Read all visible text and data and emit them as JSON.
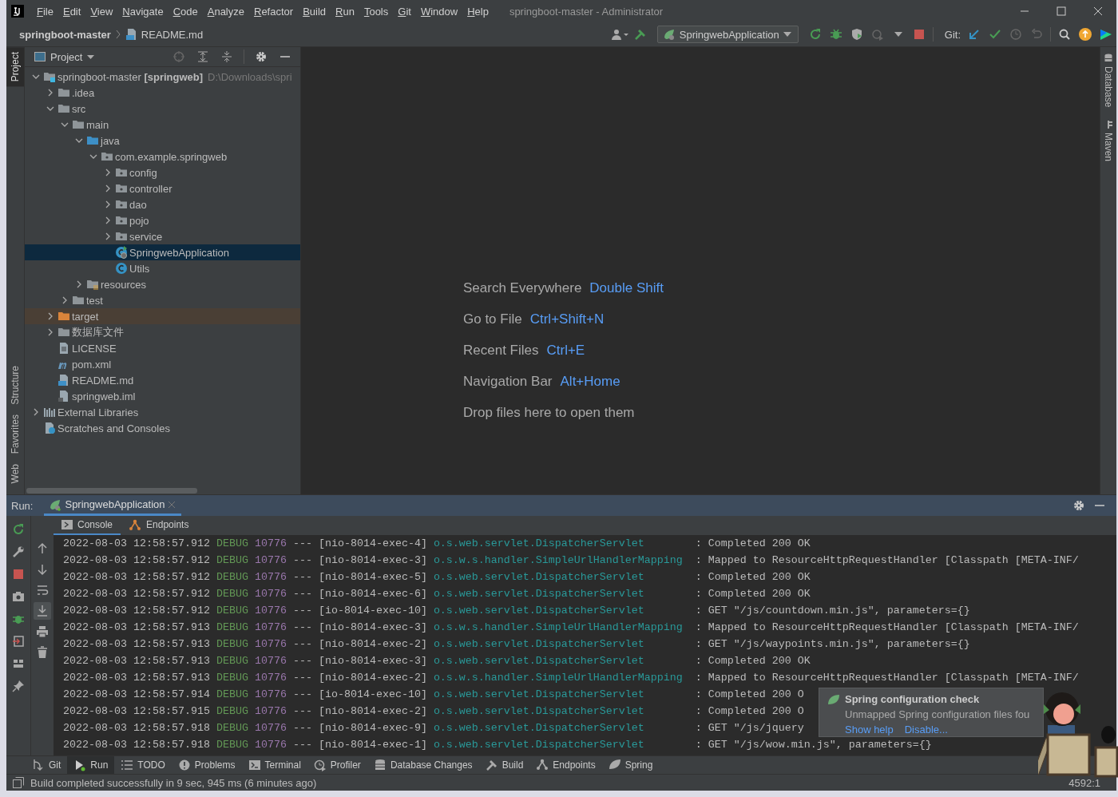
{
  "window": {
    "title": "springboot-master - Administrator",
    "menus": [
      "File",
      "Edit",
      "View",
      "Navigate",
      "Code",
      "Analyze",
      "Refactor",
      "Build",
      "Run",
      "Tools",
      "Git",
      "Window",
      "Help"
    ]
  },
  "navbar": {
    "breadcrumbs": [
      {
        "label": "springboot-master",
        "kind": "project"
      },
      {
        "label": "README.md",
        "kind": "markdown"
      }
    ],
    "run_config": "SpringwebApplication",
    "git_label": "Git:"
  },
  "left_tool_strip": [
    {
      "label": "Project",
      "selected": true
    },
    {
      "label": "Structure",
      "selected": false
    },
    {
      "label": "Favorites",
      "selected": false
    },
    {
      "label": "Web",
      "selected": false
    }
  ],
  "right_tool_strip": [
    {
      "label": "Database",
      "kind": "database"
    },
    {
      "label": "Maven",
      "kind": "maven"
    }
  ],
  "project_panel": {
    "title": "Project",
    "tree": [
      {
        "label": "springboot-master **[springweb]**",
        "path": "D:\\Downloads\\spri",
        "kind": "module",
        "expanded": true,
        "selected": false,
        "children": [
          {
            "label": ".idea",
            "kind": "folder",
            "expanded": false,
            "selected": false
          },
          {
            "label": "src",
            "kind": "folder",
            "expanded": true,
            "selected": false,
            "children": [
              {
                "label": "main",
                "kind": "folder",
                "expanded": true,
                "selected": false,
                "children": [
                  {
                    "label": "java",
                    "kind": "source-folder",
                    "expanded": true,
                    "selected": false,
                    "children": [
                      {
                        "label": "com.example.springweb",
                        "kind": "package",
                        "expanded": true,
                        "selected": false,
                        "children": [
                          {
                            "label": "config",
                            "kind": "package",
                            "expanded": false,
                            "selected": false
                          },
                          {
                            "label": "controller",
                            "kind": "package",
                            "expanded": false,
                            "selected": false
                          },
                          {
                            "label": "dao",
                            "kind": "package",
                            "expanded": false,
                            "selected": false
                          },
                          {
                            "label": "pojo",
                            "kind": "package",
                            "expanded": false,
                            "selected": false
                          },
                          {
                            "label": "service",
                            "kind": "package",
                            "expanded": false,
                            "selected": false
                          },
                          {
                            "label": "SpringwebApplication",
                            "kind": "main-class",
                            "selected": true
                          },
                          {
                            "label": "Utils",
                            "kind": "class",
                            "selected": false
                          }
                        ]
                      }
                    ]
                  },
                  {
                    "label": "resources",
                    "kind": "resources-folder",
                    "expanded": false,
                    "selected": false
                  }
                ]
              },
              {
                "label": "test",
                "kind": "folder",
                "expanded": false,
                "selected": false
              }
            ]
          },
          {
            "label": "target",
            "kind": "excluded-folder",
            "expanded": false,
            "selected": false
          },
          {
            "label": "数据库文件",
            "kind": "folder",
            "expanded": false,
            "selected": false
          },
          {
            "label": "LICENSE",
            "kind": "text-file",
            "selected": false
          },
          {
            "label": "pom.xml",
            "kind": "maven-file",
            "selected": false
          },
          {
            "label": "README.md",
            "kind": "markdown-file",
            "selected": false
          },
          {
            "label": "springweb.iml",
            "kind": "iml-file",
            "selected": false
          }
        ]
      },
      {
        "label": "External Libraries",
        "kind": "libraries",
        "expanded": false,
        "selected": false
      },
      {
        "label": "Scratches and Consoles",
        "kind": "scratches",
        "selected": false
      }
    ]
  },
  "editor_hints": [
    {
      "action": "Search Everywhere",
      "shortcut": "Double Shift"
    },
    {
      "action": "Go to File",
      "shortcut": "Ctrl+Shift+N"
    },
    {
      "action": "Recent Files",
      "shortcut": "Ctrl+E"
    },
    {
      "action": "Navigation Bar",
      "shortcut": "Alt+Home"
    },
    {
      "action": "Drop files here to open them"
    }
  ],
  "run_panel": {
    "label": "Run:",
    "tab": "SpringwebApplication",
    "subtabs": [
      {
        "label": "Console",
        "kind": "console",
        "selected": true
      },
      {
        "label": "Endpoints",
        "kind": "endpoints",
        "selected": false
      }
    ],
    "log": [
      {
        "time": "2022-08-03 12:58:57.912",
        "level": "DEBUG",
        "pid": "10776",
        "sep": "---",
        "thread": "[nio-8014-exec-4]",
        "logger": "o.s.web.servlet.DispatcherServlet",
        "message": ": Completed 200 OK"
      },
      {
        "time": "2022-08-03 12:58:57.912",
        "level": "DEBUG",
        "pid": "10776",
        "sep": "---",
        "thread": "[nio-8014-exec-3]",
        "logger": "o.s.w.s.handler.SimpleUrlHandlerMapping",
        "message": ": Mapped to ResourceHttpRequestHandler [Classpath [META-INF/"
      },
      {
        "time": "2022-08-03 12:58:57.912",
        "level": "DEBUG",
        "pid": "10776",
        "sep": "---",
        "thread": "[nio-8014-exec-5]",
        "logger": "o.s.web.servlet.DispatcherServlet",
        "message": ": Completed 200 OK"
      },
      {
        "time": "2022-08-03 12:58:57.912",
        "level": "DEBUG",
        "pid": "10776",
        "sep": "---",
        "thread": "[nio-8014-exec-6]",
        "logger": "o.s.web.servlet.DispatcherServlet",
        "message": ": Completed 200 OK"
      },
      {
        "time": "2022-08-03 12:58:57.912",
        "level": "DEBUG",
        "pid": "10776",
        "sep": "---",
        "thread": "[io-8014-exec-10]",
        "logger": "o.s.web.servlet.DispatcherServlet",
        "message": ": GET \"/js/countdown.min.js\", parameters={}"
      },
      {
        "time": "2022-08-03 12:58:57.913",
        "level": "DEBUG",
        "pid": "10776",
        "sep": "---",
        "thread": "[nio-8014-exec-3]",
        "logger": "o.s.w.s.handler.SimpleUrlHandlerMapping",
        "message": ": Mapped to ResourceHttpRequestHandler [Classpath [META-INF/"
      },
      {
        "time": "2022-08-03 12:58:57.913",
        "level": "DEBUG",
        "pid": "10776",
        "sep": "---",
        "thread": "[nio-8014-exec-2]",
        "logger": "o.s.web.servlet.DispatcherServlet",
        "message": ": GET \"/js/waypoints.min.js\", parameters={}"
      },
      {
        "time": "2022-08-03 12:58:57.913",
        "level": "DEBUG",
        "pid": "10776",
        "sep": "---",
        "thread": "[nio-8014-exec-3]",
        "logger": "o.s.web.servlet.DispatcherServlet",
        "message": ": Completed 200 OK"
      },
      {
        "time": "2022-08-03 12:58:57.913",
        "level": "DEBUG",
        "pid": "10776",
        "sep": "---",
        "thread": "[nio-8014-exec-2]",
        "logger": "o.s.w.s.handler.SimpleUrlHandlerMapping",
        "message": ": Mapped to ResourceHttpRequestHandler [Classpath [META-INF/"
      },
      {
        "time": "2022-08-03 12:58:57.914",
        "level": "DEBUG",
        "pid": "10776",
        "sep": "---",
        "thread": "[io-8014-exec-10]",
        "logger": "o.s.web.servlet.DispatcherServlet",
        "message": ": Completed 200 O"
      },
      {
        "time": "2022-08-03 12:58:57.915",
        "level": "DEBUG",
        "pid": "10776",
        "sep": "---",
        "thread": "[nio-8014-exec-2]",
        "logger": "o.s.web.servlet.DispatcherServlet",
        "message": ": Completed 200 O"
      },
      {
        "time": "2022-08-03 12:58:57.918",
        "level": "DEBUG",
        "pid": "10776",
        "sep": "---",
        "thread": "[nio-8014-exec-9]",
        "logger": "o.s.web.servlet.DispatcherServlet",
        "message": ": GET \"/js/jquery"
      },
      {
        "time": "2022-08-03 12:58:57.918",
        "level": "DEBUG",
        "pid": "10776",
        "sep": "---",
        "thread": "[nio-8014-exec-1]",
        "logger": "o.s.web.servlet.DispatcherServlet",
        "message": ": GET \"/js/wow.min.js\", parameters={}"
      }
    ]
  },
  "notification": {
    "title": "Spring configuration check",
    "body": "Unmapped Spring configuration files fou",
    "actions": [
      "Show help",
      "Disable..."
    ]
  },
  "bottom_tabs": [
    {
      "label": "Git",
      "kind": "git",
      "selected": false
    },
    {
      "label": "Run",
      "kind": "run",
      "selected": true
    },
    {
      "label": "TODO",
      "kind": "todo",
      "selected": false
    },
    {
      "label": "Problems",
      "kind": "problems",
      "selected": false
    },
    {
      "label": "Terminal",
      "kind": "terminal",
      "selected": false
    },
    {
      "label": "Profiler",
      "kind": "profiler",
      "selected": false
    },
    {
      "label": "Database Changes",
      "kind": "database",
      "selected": false
    },
    {
      "label": "Build",
      "kind": "build",
      "selected": false
    },
    {
      "label": "Endpoints",
      "kind": "endpoints",
      "selected": false
    },
    {
      "label": "Spring",
      "kind": "spring",
      "selected": false
    }
  ],
  "status_bar": {
    "message": "Build completed successfully in 9 sec, 945 ms (6 minutes ago)",
    "position": "4592:1"
  }
}
